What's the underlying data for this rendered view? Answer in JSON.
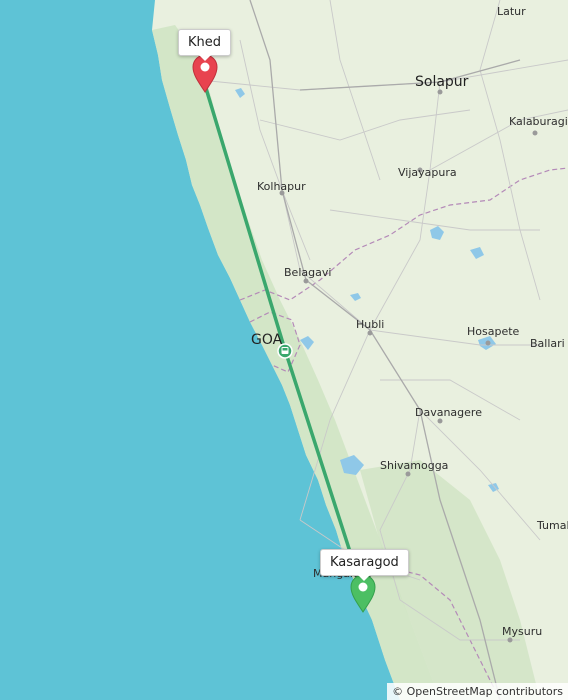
{
  "map": {
    "markers": {
      "origin": {
        "label": "Khed",
        "color": "#e8434f"
      },
      "destination": {
        "label": "Kasaragod",
        "color": "#4cbf63"
      }
    },
    "route": {
      "color": "#3aa76d"
    },
    "state_label": "GOA",
    "cities": {
      "latur": "Latur",
      "solapur": "Solapur",
      "kalaburagi": "Kalaburagi",
      "vijayapura": "Vijayapura",
      "kolhapur": "Kolhapur",
      "belagavi": "Belagavi",
      "hubli": "Hubli",
      "hosapete": "Hosapete",
      "ballari": "Ballari",
      "davanagere": "Davanagere",
      "shivamogga": "Shivamogga",
      "tumakuru": "Tumal",
      "mangaluru": "Mangaluru",
      "mysuru": "Mysuru"
    },
    "colors": {
      "sea": "#5ec3d6",
      "land": "#e9f0df"
    }
  },
  "attribution": "© OpenStreetMap contributors"
}
